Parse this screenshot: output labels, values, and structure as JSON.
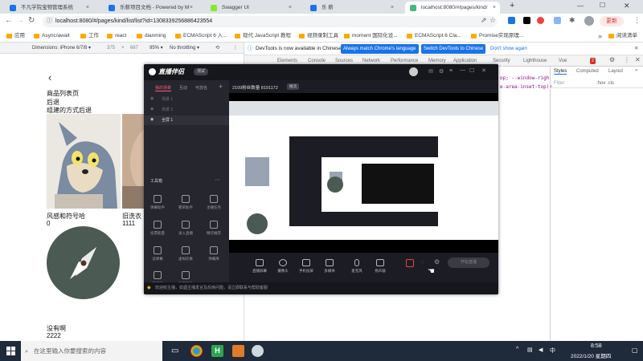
{
  "browser": {
    "tabs": [
      {
        "label": "不凡学院宝物管理系统",
        "color": "#1a73e8"
      },
      {
        "label": "乐薪项目文档 - Powered by M",
        "color": "#1a73e8"
      },
      {
        "label": "Swagger UI",
        "color": "#85ea2d"
      },
      {
        "label": "乐 薪",
        "color": "#1a73e8"
      },
      {
        "label": "localhost:8080/#/pages/kind/",
        "color": "#42b883"
      }
    ],
    "new_tab": "+",
    "url": "localhost:8080/#/pages/kind/list/list?id=1308339256886423554",
    "update_label": "更新",
    "bookmarks": [
      "应用",
      "Async/await",
      "工作",
      "react",
      "dianming",
      "ECMAScript 6 入...",
      "现代 JavaScript 教程",
      "视频录制工具",
      "moment 国际化设...",
      "ECMAScript 6 Cla...",
      "Promise实现原理..."
    ],
    "reading_list": "阅读清单"
  },
  "device_toolbar": {
    "device": "Dimensions: iPhone 6/7/8 ▾",
    "width": "375",
    "height": "667",
    "zoom": "95% ▾",
    "throttle": "No throttling ▾"
  },
  "page": {
    "back": "‹",
    "title": "商品列表页",
    "line2": "后退",
    "line3": "组建的方式后退",
    "item1_name": "风感和符号哈",
    "item1_price": "0",
    "item2_name": "旧洗衣",
    "item2_price": "1111",
    "item3_name": "没有啊",
    "item3_price": "2222"
  },
  "devtools": {
    "notice": "DevTools is now available in Chinese!",
    "btn_match": "Always match Chrome's language",
    "btn_switch": "Switch DevTools to Chinese",
    "btn_dont": "Don't show again",
    "tabs": [
      "Elements",
      "Console",
      "Sources",
      "Network",
      "Performance",
      "Memory",
      "Application",
      "Security",
      "Lighthouse",
      "Vue"
    ],
    "error_count": "2",
    "side_tabs": [
      "Styles",
      "Computed",
      "Layout"
    ],
    "filter_placeholder": "Filter",
    "hov_cls": ":hov  .cls",
    "code_line1": "op; --window-righ",
    "code_line2": "e-area-inset-top))"
  },
  "overlay": {
    "app_name": "直播伴侣",
    "app_badge": "测试",
    "nav": [
      "我的场景",
      "互动",
      "可放名"
    ],
    "add": "+",
    "scenes": [
      "场景 1",
      "场景 2",
      "全屏 1"
    ],
    "tools_title": "工具箱",
    "tools": [
      "弹幕助手",
      "繁荣助手",
      "主播任务",
      "投票能量",
      "录入直播",
      "精华推荐",
      "读弹幕",
      "虚拟形象",
      "弹幕库",
      "直播通",
      "数字形象"
    ],
    "room_info": "2109粉丝数量 8191172",
    "room_btn": "推流",
    "tab_live": "直播场景",
    "id_line": "房间号22532430   8191172",
    "viewer_count": "4",
    "bottom_tools": [
      "直播屏幕",
      "摄像头",
      "手机投屏",
      "多媒体",
      "麦克风",
      "扬声器"
    ],
    "start_label": "开始直播",
    "footer_text": "欢迎收主播，如遇主播发言及反映问题，请立即联系与帮助客服"
  },
  "taskbar": {
    "search_placeholder": "在这里输入你要搜索的内容",
    "time": "8:58",
    "date": "2022/1/20 星期四",
    "lang": "中"
  },
  "colors": {
    "chrome_tab_bg": "#dee1e6",
    "accent_blue": "#1a73e8",
    "overlay_bg": "#1c1d24",
    "taskbar_bg": "#1f2a3a",
    "compass_bg": "#4b5a52",
    "record_red": "#e8453c"
  }
}
